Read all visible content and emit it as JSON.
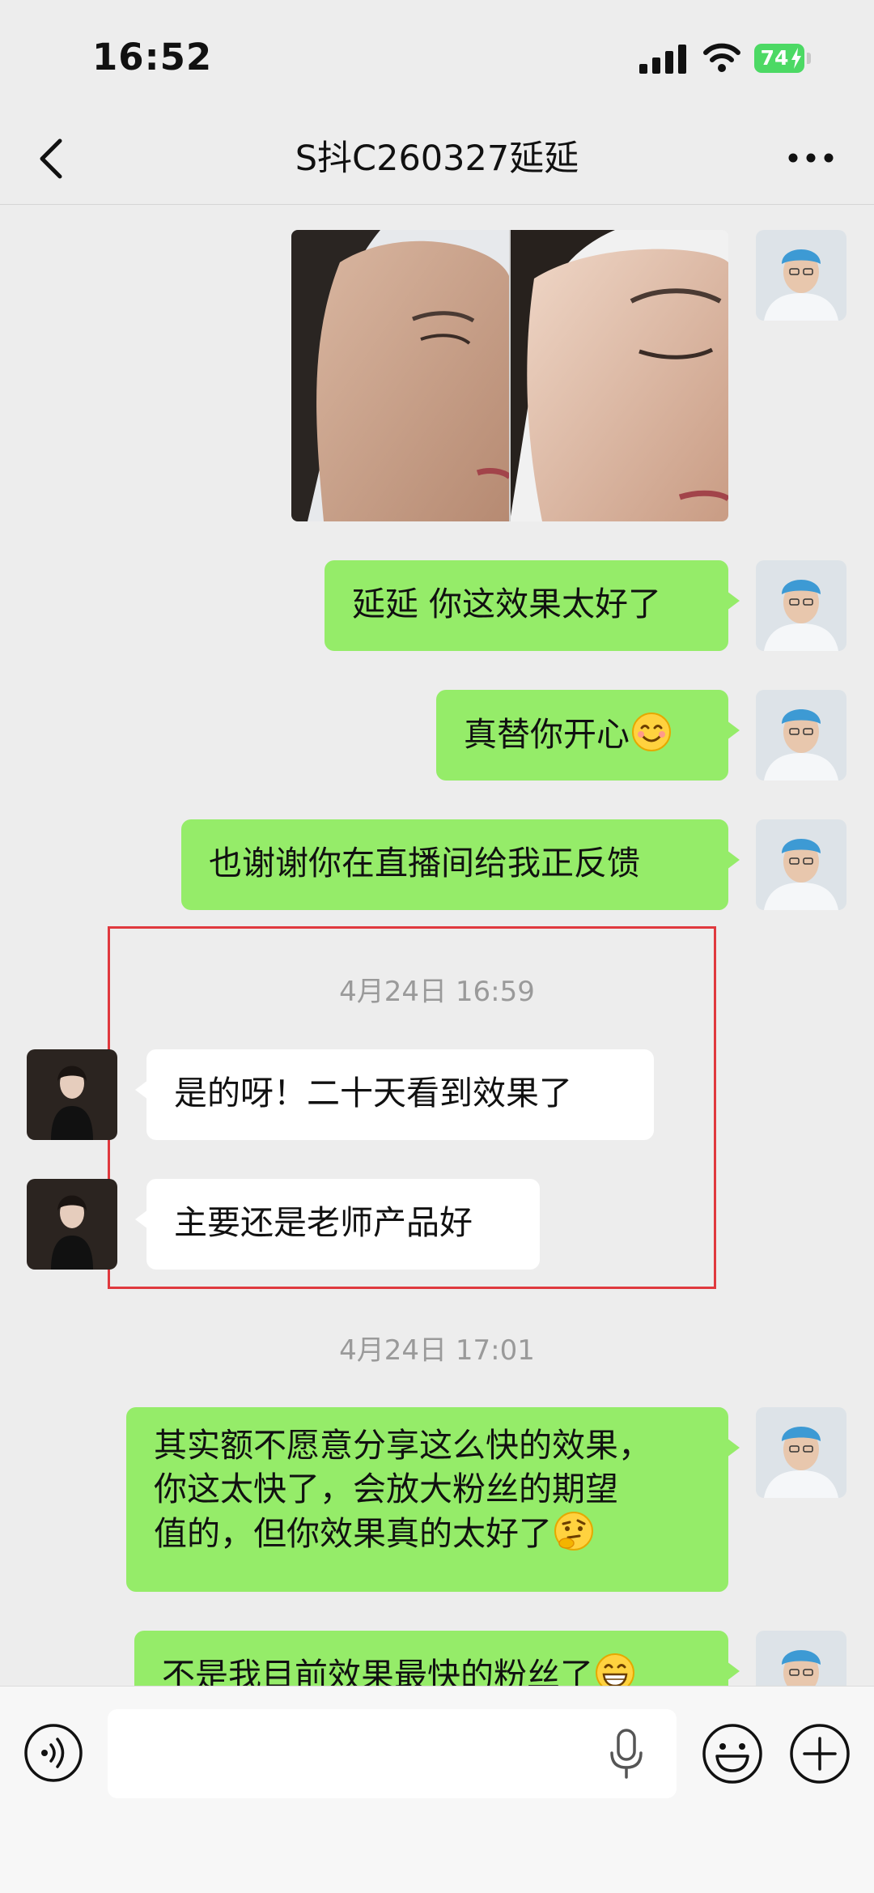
{
  "status": {
    "time": "16:52",
    "battery": "74"
  },
  "nav": {
    "title": "S抖C260327延延"
  },
  "messages": [
    {
      "text": "延延 你这效果太好了"
    },
    {
      "text": "真替你开心"
    },
    {
      "text": "也谢谢你在直播间给我正反馈"
    },
    {
      "text": "是的呀！二十天看到效果了"
    },
    {
      "text": "主要还是老师产品好"
    },
    {
      "lines": [
        "其实额不愿意分享这么快的效果，",
        "你这太快了，会放大粉丝的期望",
        "值的，但你效果真的太好了"
      ]
    },
    {
      "text": "不是我目前效果最快的粉丝了"
    }
  ],
  "timestamps": [
    "4月24日 16:59",
    "4月24日 17:01"
  ],
  "input": {
    "placeholder": ""
  },
  "colors": {
    "sent_bubble": "#95ec69",
    "received_bubble": "#ffffff",
    "highlight_border": "#e0393e",
    "battery": "#4cd964"
  }
}
